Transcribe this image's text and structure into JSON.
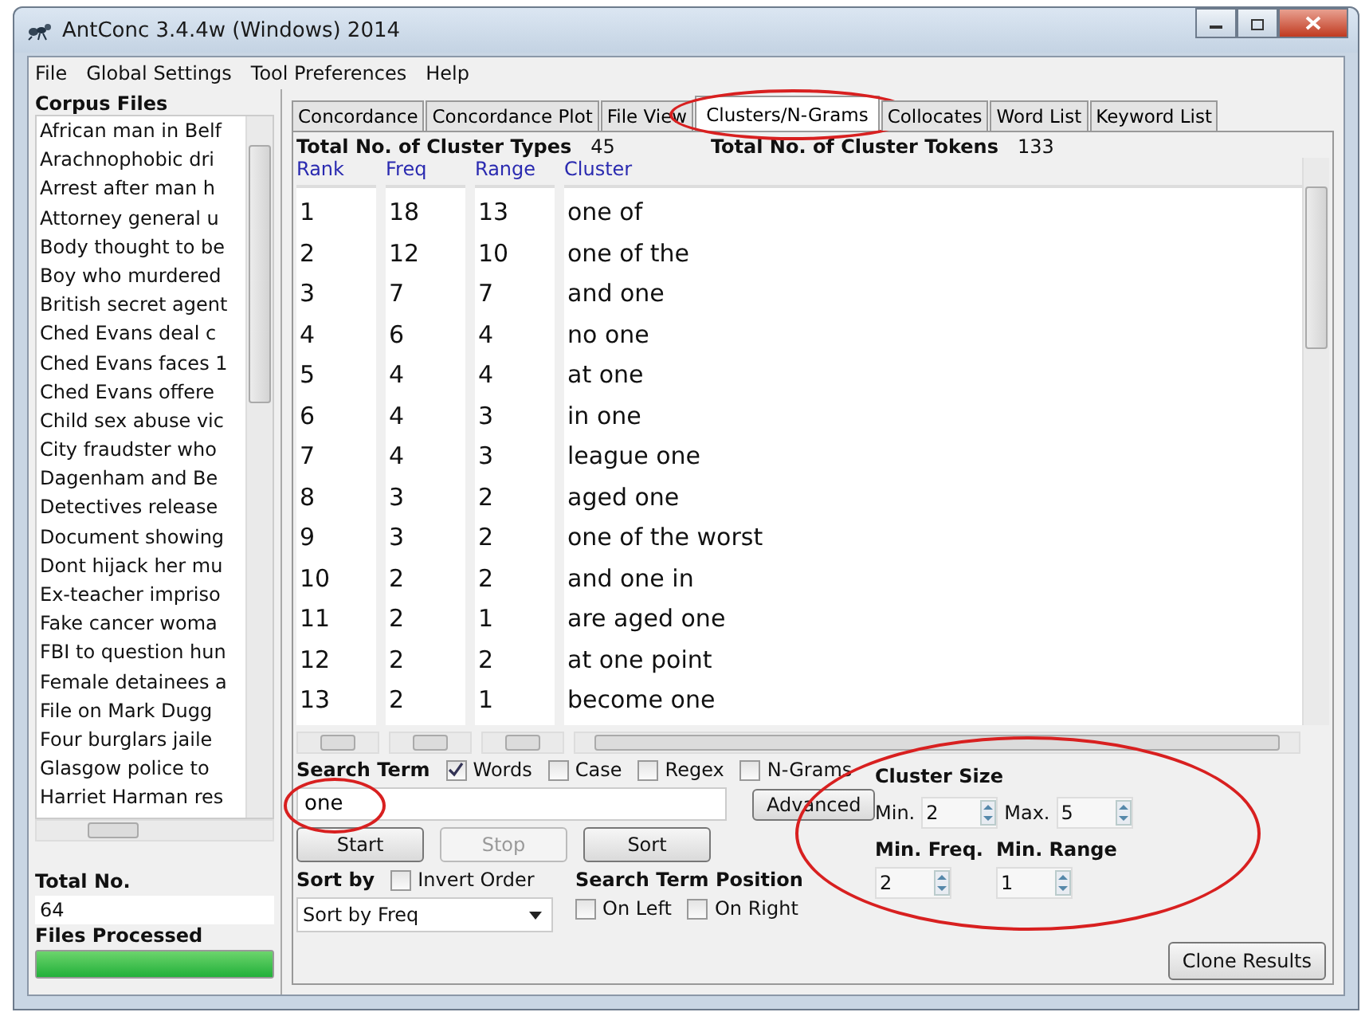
{
  "window": {
    "title": "AntConc 3.4.4w (Windows) 2014"
  },
  "menu": [
    "File",
    "Global Settings",
    "Tool Preferences",
    "Help"
  ],
  "corpus_files": {
    "label": "Corpus Files",
    "items": [
      "African man in Belf",
      "Arachnophobic dri",
      "Arrest after man h",
      "Attorney general u",
      "Body thought to be",
      "Boy who murdered",
      "British secret agent",
      "Ched Evans deal c",
      "Ched Evans faces 1",
      "Ched Evans offere",
      "Child sex abuse vic",
      "City fraudster who",
      "Dagenham and Be",
      "Detectives release",
      "Document showing",
      "Dont hijack her mu",
      "Ex-teacher impriso",
      "Fake cancer woma",
      "FBI to question hun",
      "Female detainees a",
      "File on Mark Dugg",
      "Four burglars jaile",
      "Glasgow police to",
      "Harriet Harman res"
    ],
    "total_label": "Total No.",
    "total": "64",
    "processed_label": "Files Processed",
    "progress": {
      "level": 1
    }
  },
  "tabs": [
    {
      "label": "Concordance",
      "selected": false,
      "highlighted": false
    },
    {
      "label": "Concordance Plot",
      "selected": false,
      "highlighted": false
    },
    {
      "label": "File View",
      "selected": false,
      "highlighted": false
    },
    {
      "label": "Clusters/N-Grams",
      "selected": true,
      "highlighted": true
    },
    {
      "label": "Collocates",
      "selected": false,
      "highlighted": false
    },
    {
      "label": "Word List",
      "selected": false,
      "highlighted": false
    },
    {
      "label": "Keyword List",
      "selected": false,
      "highlighted": false
    }
  ],
  "stats": [
    {
      "label": "Total No. of Cluster Types",
      "value": "45"
    },
    {
      "label": "Total No. of Cluster Tokens",
      "value": "133"
    }
  ],
  "table": {
    "columns": [
      "Rank",
      "Freq",
      "Range",
      "Cluster"
    ],
    "rows": [
      [
        "1",
        "18",
        "13",
        "one of"
      ],
      [
        "2",
        "12",
        "10",
        "one of the"
      ],
      [
        "3",
        "7",
        "7",
        "and one"
      ],
      [
        "4",
        "6",
        "4",
        "no one"
      ],
      [
        "5",
        "4",
        "4",
        "at one"
      ],
      [
        "6",
        "4",
        "3",
        "in one"
      ],
      [
        "7",
        "4",
        "3",
        "league one"
      ],
      [
        "8",
        "3",
        "2",
        "aged one"
      ],
      [
        "9",
        "3",
        "2",
        "one of the worst"
      ],
      [
        "10",
        "2",
        "2",
        "and one in"
      ],
      [
        "11",
        "2",
        "1",
        "are aged one"
      ],
      [
        "12",
        "2",
        "2",
        "at one point"
      ],
      [
        "13",
        "2",
        "1",
        "become one"
      ]
    ]
  },
  "search": {
    "label": "Search Term",
    "options": [
      {
        "label": "Words",
        "checked": true
      },
      {
        "label": "Case",
        "checked": false
      },
      {
        "label": "Regex",
        "checked": false
      },
      {
        "label": "N-Grams",
        "checked": false
      }
    ],
    "value": "one",
    "highlighted": true,
    "advanced": "Advanced"
  },
  "buttons": [
    {
      "label": "Start",
      "disabled": false
    },
    {
      "label": "Stop",
      "disabled": true
    },
    {
      "label": "Sort",
      "disabled": false
    }
  ],
  "sort": {
    "label": "Sort by",
    "invert": {
      "label": "Invert Order",
      "checked": false
    },
    "value": "Sort by Freq"
  },
  "position": {
    "label": "Search Term Position",
    "options": [
      {
        "label": "On Left",
        "checked": false
      },
      {
        "label": "On Right",
        "checked": false
      }
    ]
  },
  "cluster_settings": {
    "highlighted": true,
    "title": "Cluster Size",
    "min_label": "Min.",
    "min": "2",
    "max_label": "Max.",
    "max": "5",
    "freq_label": "Min. Freq.",
    "freq": "2",
    "range_label": "Min. Range",
    "range": "1"
  },
  "clone_button": "Clone Results"
}
